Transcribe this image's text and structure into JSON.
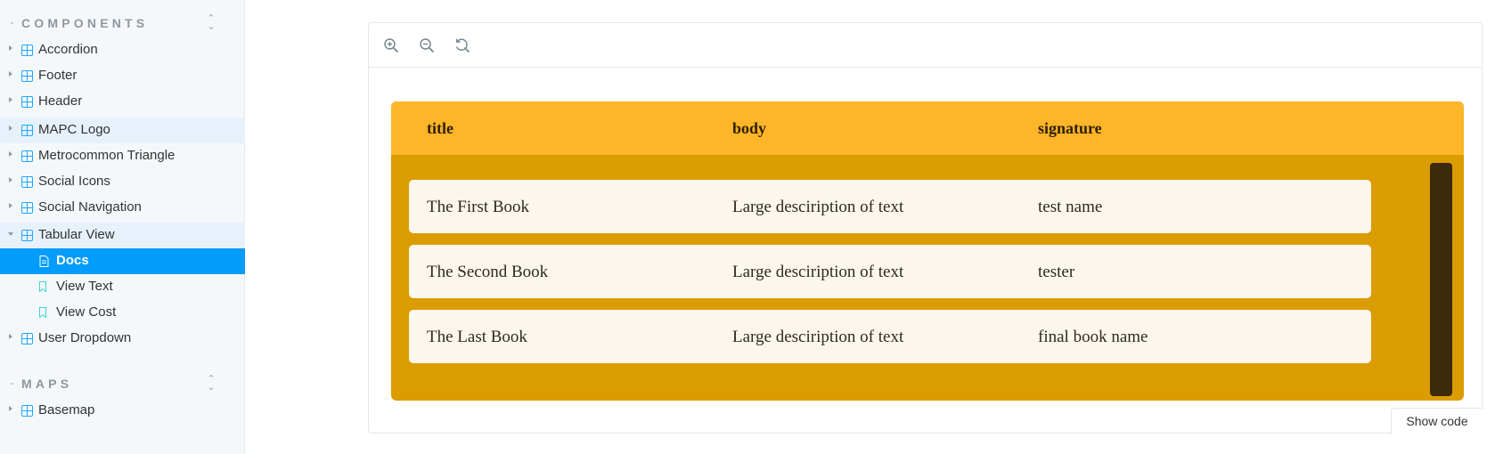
{
  "sidebar": {
    "sections": [
      {
        "title": "COMPONENTS",
        "items": [
          {
            "label": "Accordion",
            "icon": "component-icon",
            "state": "normal"
          },
          {
            "label": "Footer",
            "icon": "component-icon",
            "state": "normal"
          },
          {
            "label": "Header",
            "icon": "component-icon",
            "state": "normal"
          },
          {
            "label": "MAPC Logo",
            "icon": "component-icon",
            "state": "hover"
          },
          {
            "label": "Metrocommon Triangle",
            "icon": "component-icon",
            "state": "normal"
          },
          {
            "label": "Social Icons",
            "icon": "component-icon",
            "state": "normal"
          },
          {
            "label": "Social Navigation",
            "icon": "component-icon",
            "state": "normal"
          },
          {
            "label": "Tabular View",
            "icon": "component-icon",
            "state": "expanded",
            "children": [
              {
                "label": "Docs",
                "icon": "document-icon",
                "state": "selected"
              },
              {
                "label": "View Text",
                "icon": "bookmark-icon",
                "state": "normal"
              },
              {
                "label": "View Cost",
                "icon": "bookmark-icon",
                "state": "normal"
              }
            ]
          },
          {
            "label": "User Dropdown",
            "icon": "component-icon",
            "state": "normal"
          }
        ]
      },
      {
        "title": "MAPS",
        "items": [
          {
            "label": "Basemap",
            "icon": "component-icon",
            "state": "normal"
          }
        ]
      }
    ]
  },
  "toolbar": {
    "zoom_in": "zoom-in-icon",
    "zoom_out": "zoom-out-icon",
    "reset_zoom": "reset-zoom-icon"
  },
  "table": {
    "columns": [
      "title",
      "body",
      "signature"
    ],
    "rows": [
      [
        "The First Book",
        "Large desciription of text",
        "test name"
      ],
      [
        "The Second Book",
        "Large desciription of text",
        "tester"
      ],
      [
        "The Last Book",
        "Large desciription of text",
        "final book name"
      ]
    ]
  },
  "show_code_label": "Show code",
  "colors": {
    "accent": "#029cfd",
    "table_header": "#fdb529",
    "table_body": "#db9c00",
    "row_bg": "#fcf7ec",
    "scrollbar": "#3d2a0c"
  }
}
